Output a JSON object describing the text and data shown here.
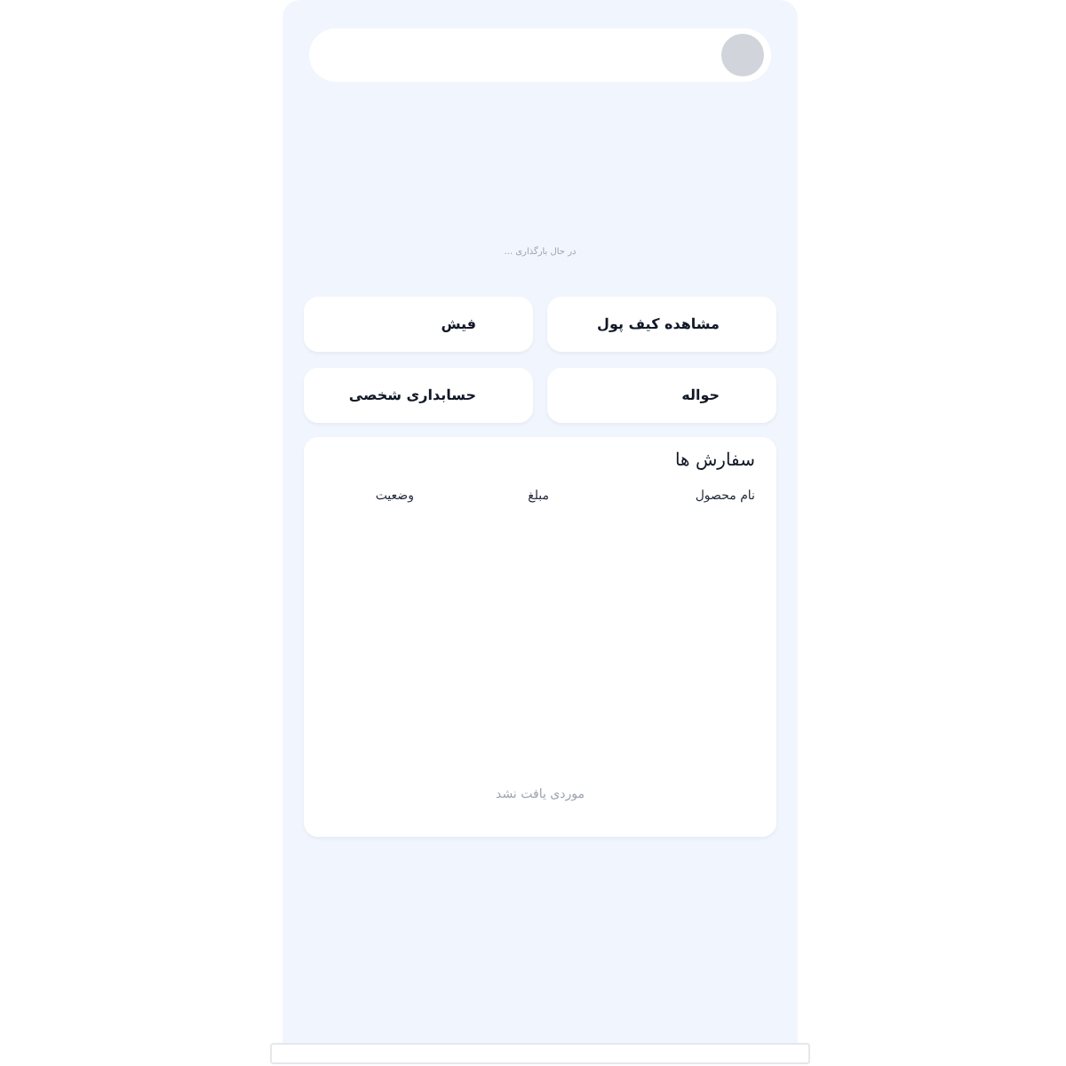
{
  "loading_text": "در حال بارگذاری ...",
  "menu_cards": [
    {
      "label": "مشاهده کیف پول"
    },
    {
      "label": "فیش"
    },
    {
      "label": "حواله"
    },
    {
      "label": "حسابداری شخصی"
    }
  ],
  "orders": {
    "title": "سفارش ها",
    "columns": [
      "نام محصول",
      "مبلغ",
      "وضعیت"
    ],
    "empty_text": "موردی یافت نشد"
  }
}
